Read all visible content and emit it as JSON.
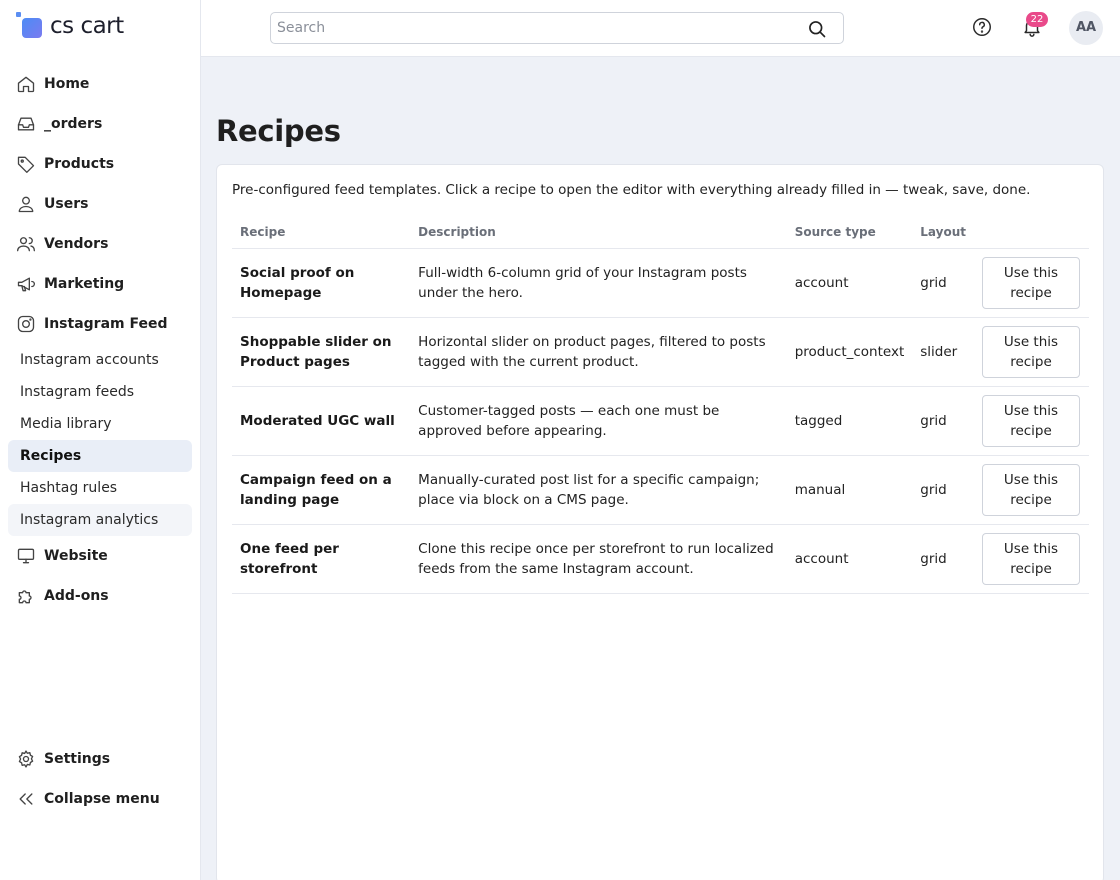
{
  "logo": {
    "text": "cs cart"
  },
  "sidebar": {
    "items": [
      {
        "label": "Home",
        "icon": "home-icon"
      },
      {
        "label": "_orders",
        "icon": "inbox-icon"
      },
      {
        "label": "Products",
        "icon": "tag-icon"
      },
      {
        "label": "Users",
        "icon": "user-icon"
      },
      {
        "label": "Vendors",
        "icon": "users-icon"
      },
      {
        "label": "Marketing",
        "icon": "megaphone-icon"
      },
      {
        "label": "Instagram Feed",
        "icon": "instagram-icon"
      }
    ],
    "subitems": [
      {
        "label": "Instagram accounts"
      },
      {
        "label": "Instagram feeds"
      },
      {
        "label": "Media library"
      },
      {
        "label": "Recipes",
        "active": true
      },
      {
        "label": "Hashtag rules"
      },
      {
        "label": "Instagram analytics"
      }
    ],
    "after": [
      {
        "label": "Website",
        "icon": "monitor-icon"
      },
      {
        "label": "Add-ons",
        "icon": "puzzle-icon"
      }
    ],
    "bottom": [
      {
        "label": "Settings",
        "icon": "gear-icon"
      },
      {
        "label": "Collapse menu",
        "icon": "chevrons-left-icon"
      }
    ]
  },
  "search": {
    "placeholder": "Search"
  },
  "notifications": {
    "count": "22"
  },
  "avatar": {
    "initials": "AA"
  },
  "page": {
    "title": "Recipes",
    "intro": "Pre-configured feed templates. Click a recipe to open the editor with everything already filled in — tweak, save, done."
  },
  "table": {
    "headers": [
      "Recipe",
      "Description",
      "Source type",
      "Layout",
      ""
    ],
    "button_label": "Use this recipe",
    "rows": [
      {
        "recipe": "Social proof on Homepage",
        "description": "Full-width 6-column grid of your Instagram posts under the hero.",
        "source_type": "account",
        "layout": "grid"
      },
      {
        "recipe": "Shoppable slider on Product pages",
        "description": "Horizontal slider on product pages, filtered to posts tagged with the current product.",
        "source_type": "product_context",
        "layout": "slider"
      },
      {
        "recipe": "Moderated UGC wall",
        "description": "Customer-tagged posts — each one must be approved before appearing.",
        "source_type": "tagged",
        "layout": "grid"
      },
      {
        "recipe": "Campaign feed on a landing page",
        "description": "Manually-curated post list for a specific campaign; place via block on a CMS page.",
        "source_type": "manual",
        "layout": "grid"
      },
      {
        "recipe": "One feed per storefront",
        "description": "Clone this recipe once per storefront to run localized feeds from the same Instagram account.",
        "source_type": "account",
        "layout": "grid"
      }
    ]
  }
}
